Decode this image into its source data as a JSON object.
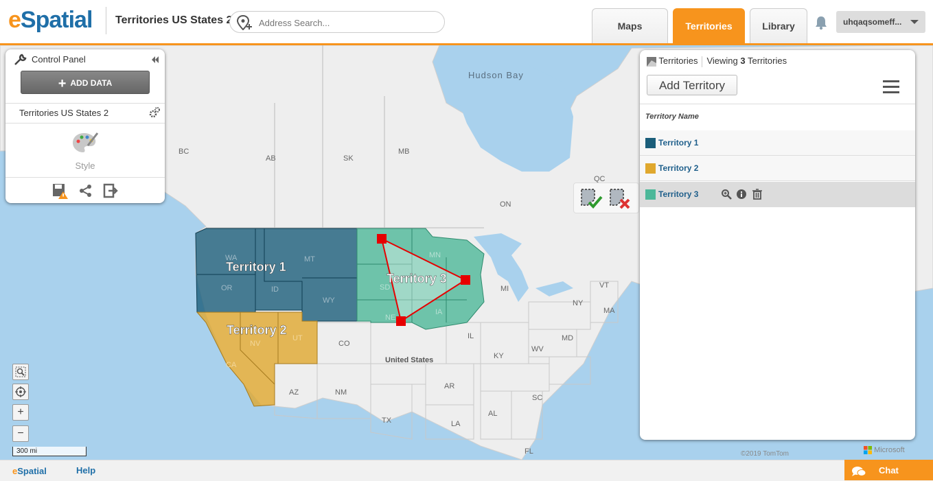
{
  "header": {
    "logo_e": "e",
    "logo_rest": "Spatial",
    "map_title": "Territories US States 2",
    "search_placeholder": "Address Search...",
    "tabs": [
      {
        "label": "Maps"
      },
      {
        "label": "Territories"
      },
      {
        "label": "Library"
      }
    ],
    "user": "uhqaqsomeff..."
  },
  "control_panel": {
    "title": "Control Panel",
    "add_data": "ADD DATA",
    "layer_name": "Territories US States 2",
    "style_label": "Style"
  },
  "territories_panel": {
    "breadcrumb": "Territories",
    "viewing_prefix": "Viewing",
    "viewing_count": "3",
    "viewing_suffix": "Territories",
    "add_button": "Add Territory",
    "column_header": "Territory Name",
    "rows": [
      {
        "name": "Territory 1",
        "color": "#1b5e7a"
      },
      {
        "name": "Territory 2",
        "color": "#e0a82e"
      },
      {
        "name": "Territory 3",
        "color": "#4db899"
      }
    ]
  },
  "map": {
    "territory_labels": [
      "Territory 1",
      "Territory 2",
      "Territory 3"
    ],
    "colors": {
      "t1": "#1b5e7a",
      "t2": "#e0a82e",
      "t3": "#4db899",
      "land": "#eeeeee",
      "water": "#a9d1ed",
      "selection": "#e60000"
    },
    "place_labels": {
      "hudson_bay": "Hudson Bay",
      "bc": "BC",
      "ab": "AB",
      "sk": "SK",
      "mb": "MB",
      "on": "ON",
      "qc": "QC",
      "wa": "WA",
      "or": "OR",
      "id": "ID",
      "mt": "MT",
      "wy": "WY",
      "ca": "CA",
      "nv": "NV",
      "ut": "UT",
      "co": "CO",
      "az": "AZ",
      "nm": "NM",
      "mn": "MN",
      "sd": "SD",
      "ne": "NE",
      "ia": "IA",
      "il": "IL",
      "mi": "MI",
      "ky": "KY",
      "tx": "TX",
      "ar": "AR",
      "la": "LA",
      "al": "AL",
      "sc": "SC",
      "fl": "FL",
      "wv": "WV",
      "md": "MD",
      "ny": "NY",
      "vt": "VT",
      "ma": "MA",
      "us": "United States"
    },
    "scale": "300 mi",
    "copyright": "©2019 TomTom",
    "ms": "Microsoft"
  },
  "footer": {
    "logo_e": "e",
    "logo_rest": "Spatial",
    "help": "Help",
    "chat": "Chat"
  }
}
